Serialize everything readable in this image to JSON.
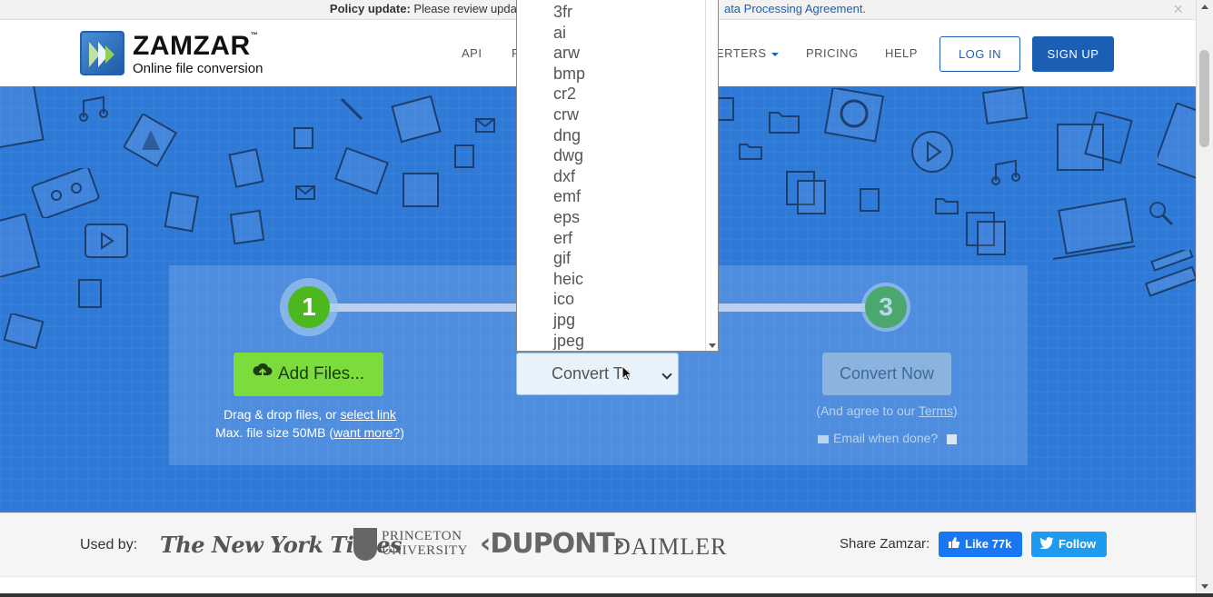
{
  "policy": {
    "bold": "Policy update:",
    "text": "Please review update",
    "link": "ata Processing Agreement.",
    "close": "×"
  },
  "header": {
    "brand": "ZAMZAR",
    "trademark": "™",
    "tagline": "Online file conversion",
    "nav": {
      "api": "API",
      "formats": "F",
      "converters": "ERTERS",
      "pricing": "PRICING",
      "help": "HELP"
    },
    "login": "LOG IN",
    "signup": "SIGN UP"
  },
  "steps": {
    "one": "1",
    "three": "3",
    "add_files": "Add Files...",
    "drag_text": "Drag & drop files, or",
    "select_link": "select link",
    "max_size": "Max. file size 50MB (",
    "want_more": "want more?",
    "max_close": ")",
    "convert_to": "Convert To",
    "convert_now": "Convert Now",
    "agree_pre": "(And agree to our",
    "terms": "Terms",
    "agree_post": ")",
    "email_label": "Email when done?"
  },
  "dropdown": {
    "options": [
      "3fr",
      "ai",
      "arw",
      "bmp",
      "cr2",
      "crw",
      "dng",
      "dwg",
      "dxf",
      "emf",
      "eps",
      "erf",
      "gif",
      "heic",
      "ico",
      "jpg",
      "jpeg"
    ]
  },
  "footer": {
    "used_by": "Used by:",
    "brands": {
      "nyt": "The New York Times",
      "princeton_1": "PRINCETON",
      "princeton_2": "UNIVERSITY",
      "dupont": "‹DUPONT›",
      "daimler": "DAIMLER"
    },
    "share": "Share Zamzar:",
    "like": "Like 77k",
    "follow": "Follow"
  },
  "colors": {
    "hero": "#2f7ad7",
    "brand_blue": "#1a5fb4",
    "green": "#7bdc3c",
    "facebook": "#1877f2",
    "twitter": "#1d9bf0"
  }
}
